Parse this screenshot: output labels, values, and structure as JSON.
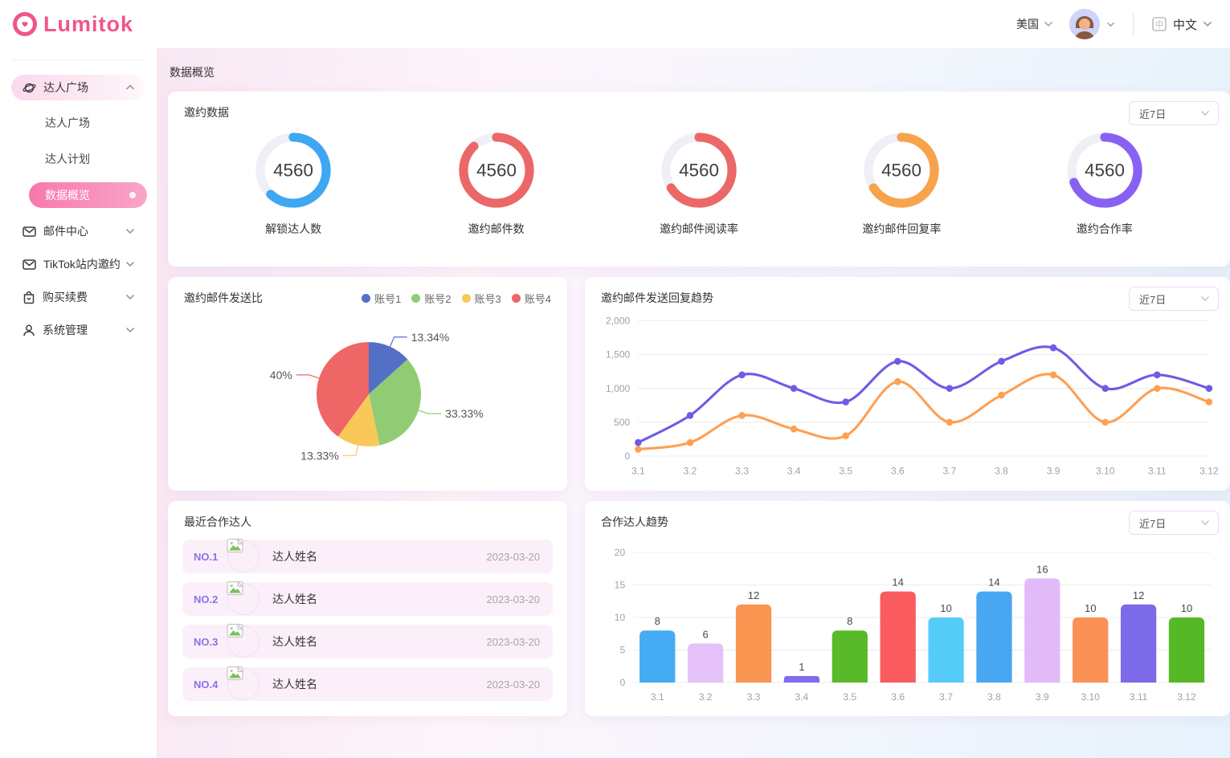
{
  "header": {
    "logo_text": "Lumitok",
    "country": "美国",
    "language": "中文"
  },
  "sidebar": {
    "groups": [
      {
        "label": "达人广场",
        "icon": "planet-icon",
        "expanded": true,
        "children": [
          {
            "label": "达人广场",
            "active": false
          },
          {
            "label": "达人计划",
            "active": false
          },
          {
            "label": "数据概览",
            "active": true
          }
        ]
      },
      {
        "label": "邮件中心",
        "icon": "mail-icon"
      },
      {
        "label": "TikTok站内邀约",
        "icon": "mail-icon"
      },
      {
        "label": "购买续费",
        "icon": "bag-icon"
      },
      {
        "label": "系统管理",
        "icon": "user-icon"
      }
    ]
  },
  "page": {
    "title": "数据概览"
  },
  "recent_partners": {
    "title": "最近合作达人",
    "rows": [
      {
        "rank": "NO.1",
        "name": "达人姓名",
        "date": "2023-03-20"
      },
      {
        "rank": "NO.2",
        "name": "达人姓名",
        "date": "2023-03-20"
      },
      {
        "rank": "NO.3",
        "name": "达人姓名",
        "date": "2023-03-20"
      },
      {
        "rank": "NO.4",
        "name": "达人姓名",
        "date": "2023-03-20"
      }
    ]
  },
  "chart_data": [
    {
      "type": "donut",
      "title": "邀约数据",
      "period": "近7日",
      "metrics": [
        {
          "label": "解锁达人数",
          "value": "4560",
          "percent": 62,
          "color": "#3fa7f1"
        },
        {
          "label": "邀约邮件数",
          "value": "4560",
          "percent": 88,
          "color": "#ec6767"
        },
        {
          "label": "邀约邮件阅读率",
          "value": "4560",
          "percent": 66,
          "color": "#ec6767"
        },
        {
          "label": "邀约邮件回复率",
          "value": "4560",
          "percent": 66,
          "color": "#f7a34c"
        },
        {
          "label": "邀约合作率",
          "value": "4560",
          "percent": 69,
          "color": "#8961f2"
        }
      ],
      "track_color": "#eef0f6"
    },
    {
      "type": "pie",
      "title": "邀约邮件发送比",
      "legend_position": "top-right",
      "slices": [
        {
          "name": "账号1",
          "pct": 13.34,
          "label": "13.34%",
          "color": "#5470c6"
        },
        {
          "name": "账号2",
          "pct": 33.33,
          "label": "33.33%",
          "color": "#91cc75"
        },
        {
          "name": "账号3",
          "pct": 13.33,
          "label": "13.33%",
          "color": "#fac858"
        },
        {
          "name": "账号4",
          "pct": 40.0,
          "label": "40%",
          "color": "#ee6666"
        }
      ]
    },
    {
      "type": "line",
      "title": "邀约邮件发送回复趋势",
      "period": "近7日",
      "x": [
        "3.1",
        "3.2",
        "3.3",
        "3.4",
        "3.5",
        "3.6",
        "3.7",
        "3.8",
        "3.9",
        "3.10",
        "3.11",
        "3.12"
      ],
      "ylim": [
        0,
        2000
      ],
      "ytick_values": [
        0,
        500,
        1000,
        1500,
        2000
      ],
      "ytick_labels": [
        "0",
        "500",
        "1,000",
        "1,500",
        "2,000"
      ],
      "grid": true,
      "smooth": true,
      "series": [
        {
          "color": "#6c5ce7",
          "values": [
            200,
            600,
            1200,
            1000,
            800,
            1400,
            1000,
            1400,
            1600,
            1000,
            1200,
            1000
          ]
        },
        {
          "color": "#ff9f51",
          "values": [
            100,
            200,
            600,
            400,
            300,
            1100,
            500,
            900,
            1200,
            500,
            1000,
            800
          ]
        }
      ]
    },
    {
      "type": "bar",
      "title": "合作达人趋势",
      "period": "近7日",
      "categories": [
        "3.1",
        "3.2",
        "3.3",
        "3.4",
        "3.5",
        "3.6",
        "3.7",
        "3.8",
        "3.9",
        "3.10",
        "3.11",
        "3.12"
      ],
      "values": [
        8,
        6,
        12,
        1,
        8,
        14,
        10,
        14,
        16,
        10,
        12,
        10
      ],
      "bar_colors": [
        "#45abf2",
        "#e4c1f8",
        "#fa9552",
        "#7d6bf0",
        "#58ba29",
        "#f95b5f",
        "#55ccf8",
        "#48a6f2",
        "#e2baf8",
        "#fa9155",
        "#7c6ae8",
        "#57b827"
      ],
      "ylim": [
        0,
        20
      ],
      "yticks": [
        0,
        5,
        10,
        15,
        20
      ],
      "grid": true
    }
  ]
}
